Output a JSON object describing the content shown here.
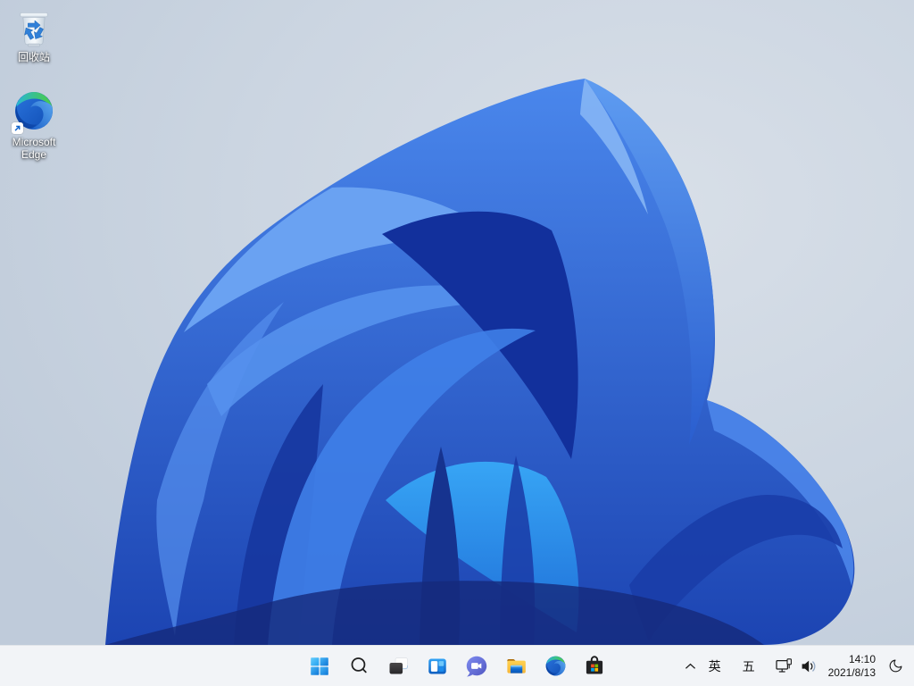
{
  "desktop": {
    "icons": [
      {
        "id": "recycle-bin",
        "label": "回收站",
        "icon": "recycle-bin-icon"
      },
      {
        "id": "microsoft-edge",
        "label": "Microsoft Edge",
        "icon": "edge-logo-icon",
        "has_shortcut_arrow": true
      }
    ]
  },
  "taskbar": {
    "buttons": [
      {
        "id": "start",
        "icon": "windows-start-icon"
      },
      {
        "id": "search",
        "icon": "search-icon"
      },
      {
        "id": "task-view",
        "icon": "task-view-icon"
      },
      {
        "id": "widgets",
        "icon": "widgets-icon"
      },
      {
        "id": "chat",
        "icon": "teams-chat-icon"
      },
      {
        "id": "file-explorer",
        "icon": "folder-icon"
      },
      {
        "id": "edge",
        "icon": "edge-logo-icon"
      },
      {
        "id": "microsoft-store",
        "icon": "store-bag-icon"
      }
    ],
    "tray": {
      "hidden_icons": "chevron-up-icon",
      "ime_language": "英",
      "ime_layout": "五",
      "network": "wired-network-icon",
      "volume": "speaker-icon",
      "clock": {
        "time": "14:10",
        "date": "2021/8/13"
      },
      "night_mode": "crescent-moon-icon"
    }
  },
  "colors": {
    "taskbar_background": "#f2f4f7",
    "wallpaper_background": "#c9d4e0",
    "bloom_blue": "#2a5ecf",
    "bloom_dark": "#12309c",
    "bloom_light": "#6aa2f2",
    "start_blue": "#0e76d6"
  }
}
